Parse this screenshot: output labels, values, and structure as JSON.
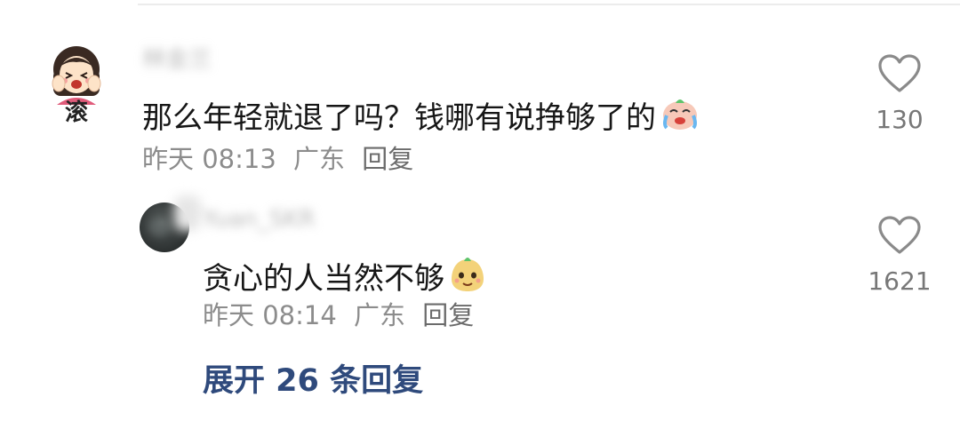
{
  "comment": {
    "avatar_caption": "滚",
    "username": "林金兰",
    "text": "那么年轻就退了吗？钱哪有说挣够了的",
    "emoji": "crying-laughing-face",
    "time": "昨天 08:13",
    "location": "广东",
    "reply_label": "回复",
    "likes": "130"
  },
  "reply": {
    "username": "Yuan_SKR",
    "text": "贪心的人当然不够",
    "emoji": "smirking-pear-face",
    "time": "昨天 08:14",
    "location": "广东",
    "reply_label": "回复",
    "likes": "1621"
  },
  "expand": {
    "label": "展开 26 条回复"
  },
  "colors": {
    "text": "#161616",
    "meta": "#8c8c8c",
    "link": "#2f4a7c",
    "like_icon": "#8a8a8a"
  }
}
